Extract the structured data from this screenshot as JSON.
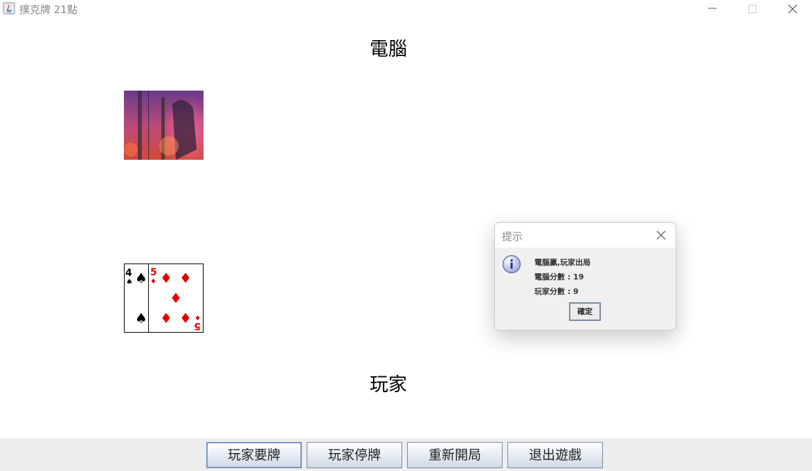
{
  "window": {
    "title": "撲克牌 21點"
  },
  "labels": {
    "computer": "電腦",
    "player": "玩家"
  },
  "computer_hand": {
    "cards": [
      "card-back",
      "card-back"
    ]
  },
  "player_hand": {
    "cards": [
      {
        "rank": "4",
        "suit": "spades"
      },
      {
        "rank": "5",
        "suit": "diamonds"
      }
    ]
  },
  "dialog": {
    "title": "提示",
    "lines": [
      "電腦贏,玩家出局",
      "電腦分數 : 19",
      "玩家分數 : 9"
    ],
    "ok_label": "確定"
  },
  "buttons": {
    "hit": "玩家要牌",
    "stand": "玩家停牌",
    "restart": "重新開局",
    "exit": "退出遊戲"
  },
  "colors": {
    "spade": "#000000",
    "diamond": "#e60000",
    "card_back_top": "#7a3d8f",
    "card_back_bottom": "#d34a3c"
  }
}
